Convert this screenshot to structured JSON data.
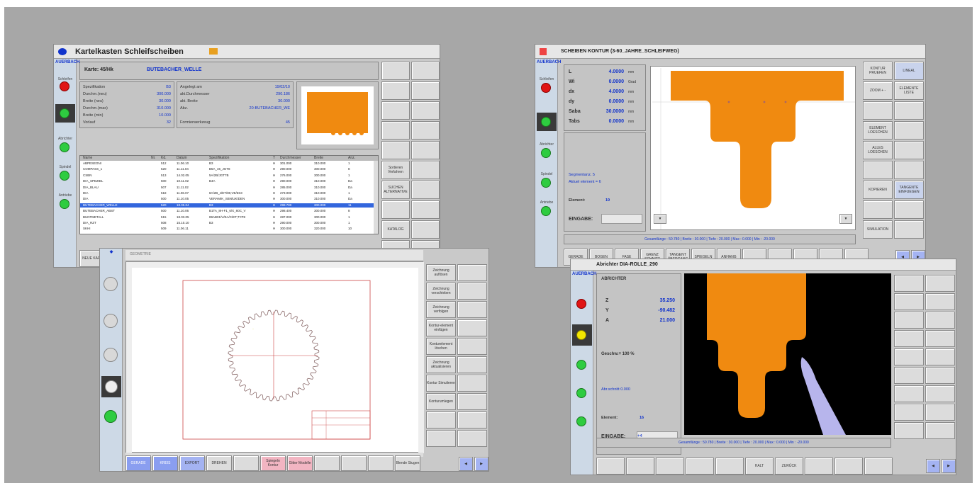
{
  "w1": {
    "title": "Kartelkasten Schleifscheiben",
    "card_label": "Karte: 45/Hk",
    "card_name": "BUTEBACHER_WELLE",
    "params_left": [
      {
        "k": "Spezifikation",
        "v": "B3"
      },
      {
        "k": "Durchm.(neu)",
        "v": "300.000"
      },
      {
        "k": "Breite (neu)",
        "v": "30.000"
      },
      {
        "k": "Durchm.(max)",
        "v": "310.000"
      },
      {
        "k": "Breite (min)",
        "v": "10.000"
      },
      {
        "k": "Vorlauf",
        "v": "32"
      }
    ],
    "params_right": [
      {
        "k": "Angelegt am",
        "v": "19/02/10"
      },
      {
        "k": "akt.Durchmesser",
        "v": "290.186"
      },
      {
        "k": "akt. Breite",
        "v": "30.000"
      },
      {
        "k": "Abz.",
        "v": "20-BUTEBACHER_WE"
      },
      {
        "k": "Formierwerkzeug",
        "v": "45"
      }
    ],
    "table_headers": [
      "Name",
      "Nr.",
      "Kd.",
      "Datum",
      "Spezifikation",
      "T",
      "Durchmesser",
      "Breite",
      "Anz."
    ],
    "rows": [
      [
        "ABPESEGNI",
        "",
        "512",
        "11.06.10",
        "B3",
        "H",
        "301.000",
        "310.000",
        "1"
      ],
      [
        "COMPASS_1",
        "",
        "520",
        "11.11.04",
        "B5A_46_JGT8",
        "H",
        "290.000",
        "300.000",
        "8"
      ],
      [
        "CSBN",
        "",
        "513",
        "14.02.05",
        "5A/2B/JGT7B",
        "H",
        "276.000",
        "300.000",
        "1"
      ],
      [
        "DIA_SPEZIEL",
        "",
        "500",
        "10.11.02",
        "B4A",
        "H",
        "290.000",
        "310.000",
        "Da"
      ],
      [
        "DIA_BLAU",
        "",
        "507",
        "11.11.02",
        "",
        "H",
        "285.000",
        "310.000",
        "Da"
      ],
      [
        "DIA",
        "",
        "518",
        "11.06.07",
        "8A/2B_J/ET/80,VE/6S3",
        "H",
        "273.000",
        "310.000",
        "1"
      ],
      [
        "DIA",
        "",
        "500",
        "11.10.05",
        "VERAMIK_SBN/UK/DEN",
        "H",
        "300.000",
        "310.000",
        "Da"
      ],
      [
        "BUTEBACHER_WELLE",
        "",
        "520",
        "18.05.04",
        "B3",
        "H",
        "298.780",
        "300.000",
        "11"
      ],
      [
        "BUTEBACHER_ABST",
        "",
        "500",
        "11.10.06",
        "B1TA_8H-F1_6/X_80C_V",
        "H",
        "298.400",
        "300.000",
        "8"
      ],
      [
        "BUNTMETALL",
        "",
        "515",
        "18.03.05",
        "89AB01/V/EA/C/ET,TYP8",
        "H",
        "287.000",
        "300.000",
        "1"
      ],
      [
        "DIA_RZT",
        "",
        "508",
        "15.10.10",
        "B3",
        "H",
        "290.000",
        "300.000",
        "1"
      ],
      [
        "SKHI",
        "",
        "509",
        "11.06.11",
        "",
        "H",
        "300.000",
        "320.000",
        "10"
      ]
    ],
    "right_keys": [
      "",
      "",
      "",
      "",
      "",
      "Sortieren Verfahren",
      "SUCHEN ALTERNATIVE",
      "",
      "KATALOG",
      "",
      "",
      "",
      ""
    ],
    "bottom_keys": [
      "NEUE KARTE",
      "LOESCHE KARTE",
      "KOPIEREN KARTE",
      "KOPIERE KARTE",
      "GENERE KARTE",
      "SUCHE KARTE",
      "SCHEIBEN KONTUR",
      "",
      "",
      "",
      "",
      ""
    ]
  },
  "w2": {
    "title": "SCHEIBEN KONTUR (3-60_JAHRE_SCHLEIFWEG)",
    "params": [
      {
        "k": "L",
        "v": "4.0000",
        "u": "mm"
      },
      {
        "k": "Wi",
        "v": "0.0000",
        "u": "Grad"
      },
      {
        "k": "dx",
        "v": "4.0000",
        "u": "mm"
      },
      {
        "k": "dy",
        "v": "0.0000",
        "u": "mm"
      },
      {
        "k": "Saba",
        "v": "30.0000",
        "u": "mm"
      },
      {
        "k": "Tabs",
        "v": "0.0000",
        "u": "mm"
      }
    ],
    "info1": "Segmentanz. 5",
    "info2": "Aktuel element = 6",
    "element_label": "Element:",
    "element_value": "19",
    "eingabe_label": "EINGABE:",
    "status": "Gesamtlänge : 50.780 | Breite : 30.000 | Tiefe : 20.000 | Max : 0.000 | Min : -20.000",
    "right_keys": [
      "KONTUR PRUEFEN",
      "LINEAL",
      "ZOOM + -",
      "ELEMENTE LISTE",
      "",
      "",
      "ELEMENT LOESCHEN",
      "",
      "ALLES LOESCHEN",
      "",
      "",
      "",
      "KOPIEREN",
      "TANGENTE EINFUEGEN",
      "",
      "",
      "SIMULATION",
      ""
    ],
    "bottom_keys": [
      "GERADE",
      "BOGEN",
      "FASE",
      "GRENZ SCHNITT",
      "TANGENT ÜBERGANG",
      "SPIEGELN",
      "ANHANG",
      "",
      "",
      "",
      "",
      ""
    ]
  },
  "w3": {
    "title": "GEOMETRIE",
    "right_keys": [
      "Zeichnung auflösen",
      "Zeichnung verschieben",
      "Zeichnung verfolgen",
      "Kontur-element einfügen",
      "Konturelement löschen",
      "Zeichnung aktualisieren",
      "Kontur Simulieren",
      "Konturumlegen",
      "",
      ""
    ],
    "bottom_keys": [
      "GERADE",
      "KREIS",
      "EXPORT",
      "DREHEN",
      "",
      "Spiegeln Kontur",
      "Gitter Modelle",
      "",
      "",
      "",
      "Blende Stugen"
    ]
  },
  "w4": {
    "title": "Abrichter  DIA-ROLLE_290",
    "abrichter_label": "ABRICHTER",
    "coords": [
      {
        "k": "Z",
        "v": "35.250"
      },
      {
        "k": "Y",
        "v": "-90.482"
      },
      {
        "k": "A",
        "v": "21.000"
      }
    ],
    "speed": "Geschw.= 100 %",
    "info": "Abr.schnitt 0.000",
    "element_label": "Element:",
    "element_value": "16",
    "eingabe_label": "EINGABE:",
    "eingabe_value": "+4",
    "status": "Gesamtlänge : 50.780 | Breite : 30.000 | Tiefe : 20.000 | Max : 0.000 | Min : -20.000",
    "bottom_keys": [
      "",
      "",
      "",
      "",
      "",
      "HALT",
      "ZURÜCK",
      "",
      "",
      ""
    ]
  },
  "shared": {
    "logo": "AUERBACH",
    "led_labels": [
      "Schleifen",
      "Maschine",
      "Abrichter",
      "Spindel",
      "Antriebe"
    ],
    "nav_prev": "◀",
    "nav_next": "▶"
  }
}
